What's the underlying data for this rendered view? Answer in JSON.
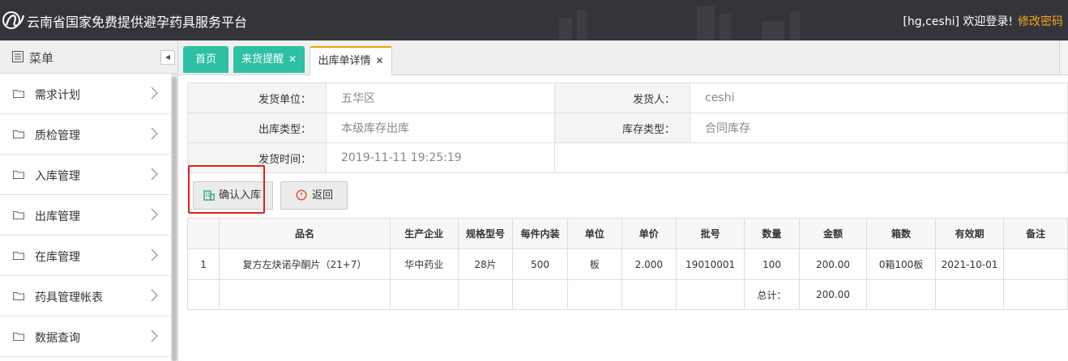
{
  "header": {
    "app_title": "云南省国家免费提供避孕药具服务平台",
    "user_greeting": "[hg,ceshi] 欢迎登录!",
    "change_password": "修改密码"
  },
  "sidebar": {
    "title": "菜单",
    "items": [
      {
        "label": "需求计划"
      },
      {
        "label": "质检管理"
      },
      {
        "label": "入库管理"
      },
      {
        "label": "出库管理"
      },
      {
        "label": "在库管理"
      },
      {
        "label": "药具管理帐表"
      },
      {
        "label": "数据查询"
      }
    ]
  },
  "tabs": [
    {
      "label": "首页"
    },
    {
      "label": "来货提醒"
    },
    {
      "label": "出库单详情"
    }
  ],
  "info": {
    "ship_unit_label": "发货单位：",
    "ship_unit_value": "五华区",
    "shipper_label": "发货人：",
    "shipper_value": "ceshi",
    "out_type_label": "出库类型：",
    "out_type_value": "本级库存出库",
    "stock_type_label": "库存类型：",
    "stock_type_value": "合同库存",
    "ship_time_label": "发货时间：",
    "ship_time_value": "2019-11-11 19:25:19"
  },
  "buttons": {
    "confirm": "确认入库",
    "back": "返回"
  },
  "table": {
    "headers": [
      "品名",
      "生产企业",
      "规格型号",
      "每件内装",
      "单位",
      "单价",
      "批号",
      "数量",
      "金额",
      "箱数",
      "有效期",
      "备注"
    ],
    "rows": [
      {
        "index": "1",
        "name": "复方左炔诺孕酮片（21+7）",
        "maker": "华中药业",
        "spec": "28片",
        "per_piece": "500",
        "unit": "板",
        "price": "2.000",
        "batch": "19010001",
        "qty": "100",
        "amount": "200.00",
        "boxes": "0箱100板",
        "expiry": "2021-10-01",
        "remark": ""
      }
    ],
    "total_label": "总计：",
    "total_amount": "200.00"
  }
}
